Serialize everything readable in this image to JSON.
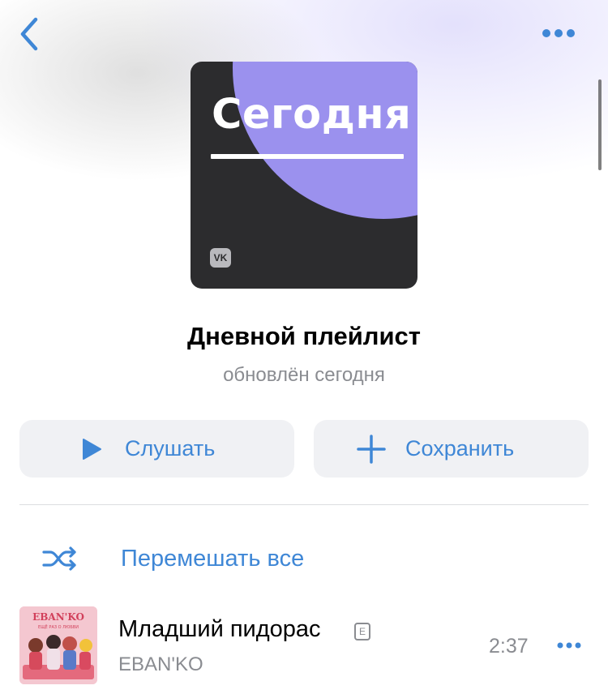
{
  "header": {
    "back_icon": "chevron-left-icon",
    "more_icon": "more-horizontal-icon"
  },
  "cover": {
    "title": "Сегодня",
    "logo": "VK",
    "colors": {
      "background": "#2c2c2e",
      "circle": "#9b91ee"
    }
  },
  "playlist": {
    "title": "Дневной плейлист",
    "subtitle": "обновлён сегодня"
  },
  "actions": {
    "listen_label": "Слушать",
    "listen_icon": "play-icon",
    "save_label": "Сохранить",
    "save_icon": "plus-icon"
  },
  "shuffle": {
    "label": "Перемешать все",
    "icon": "shuffle-icon"
  },
  "tracks": [
    {
      "title": "Младший пидорас",
      "explicit_badge": "E",
      "artist": "EBAN'KO",
      "duration": "2:37",
      "art_text": "EBAN'KO",
      "art_subtext": "ЕЩЁ РАЗ О ЛЮБВИ"
    }
  ],
  "colors": {
    "accent": "#3f87d6",
    "secondary_text": "#8a8c91",
    "button_bg": "#f0f1f4"
  }
}
